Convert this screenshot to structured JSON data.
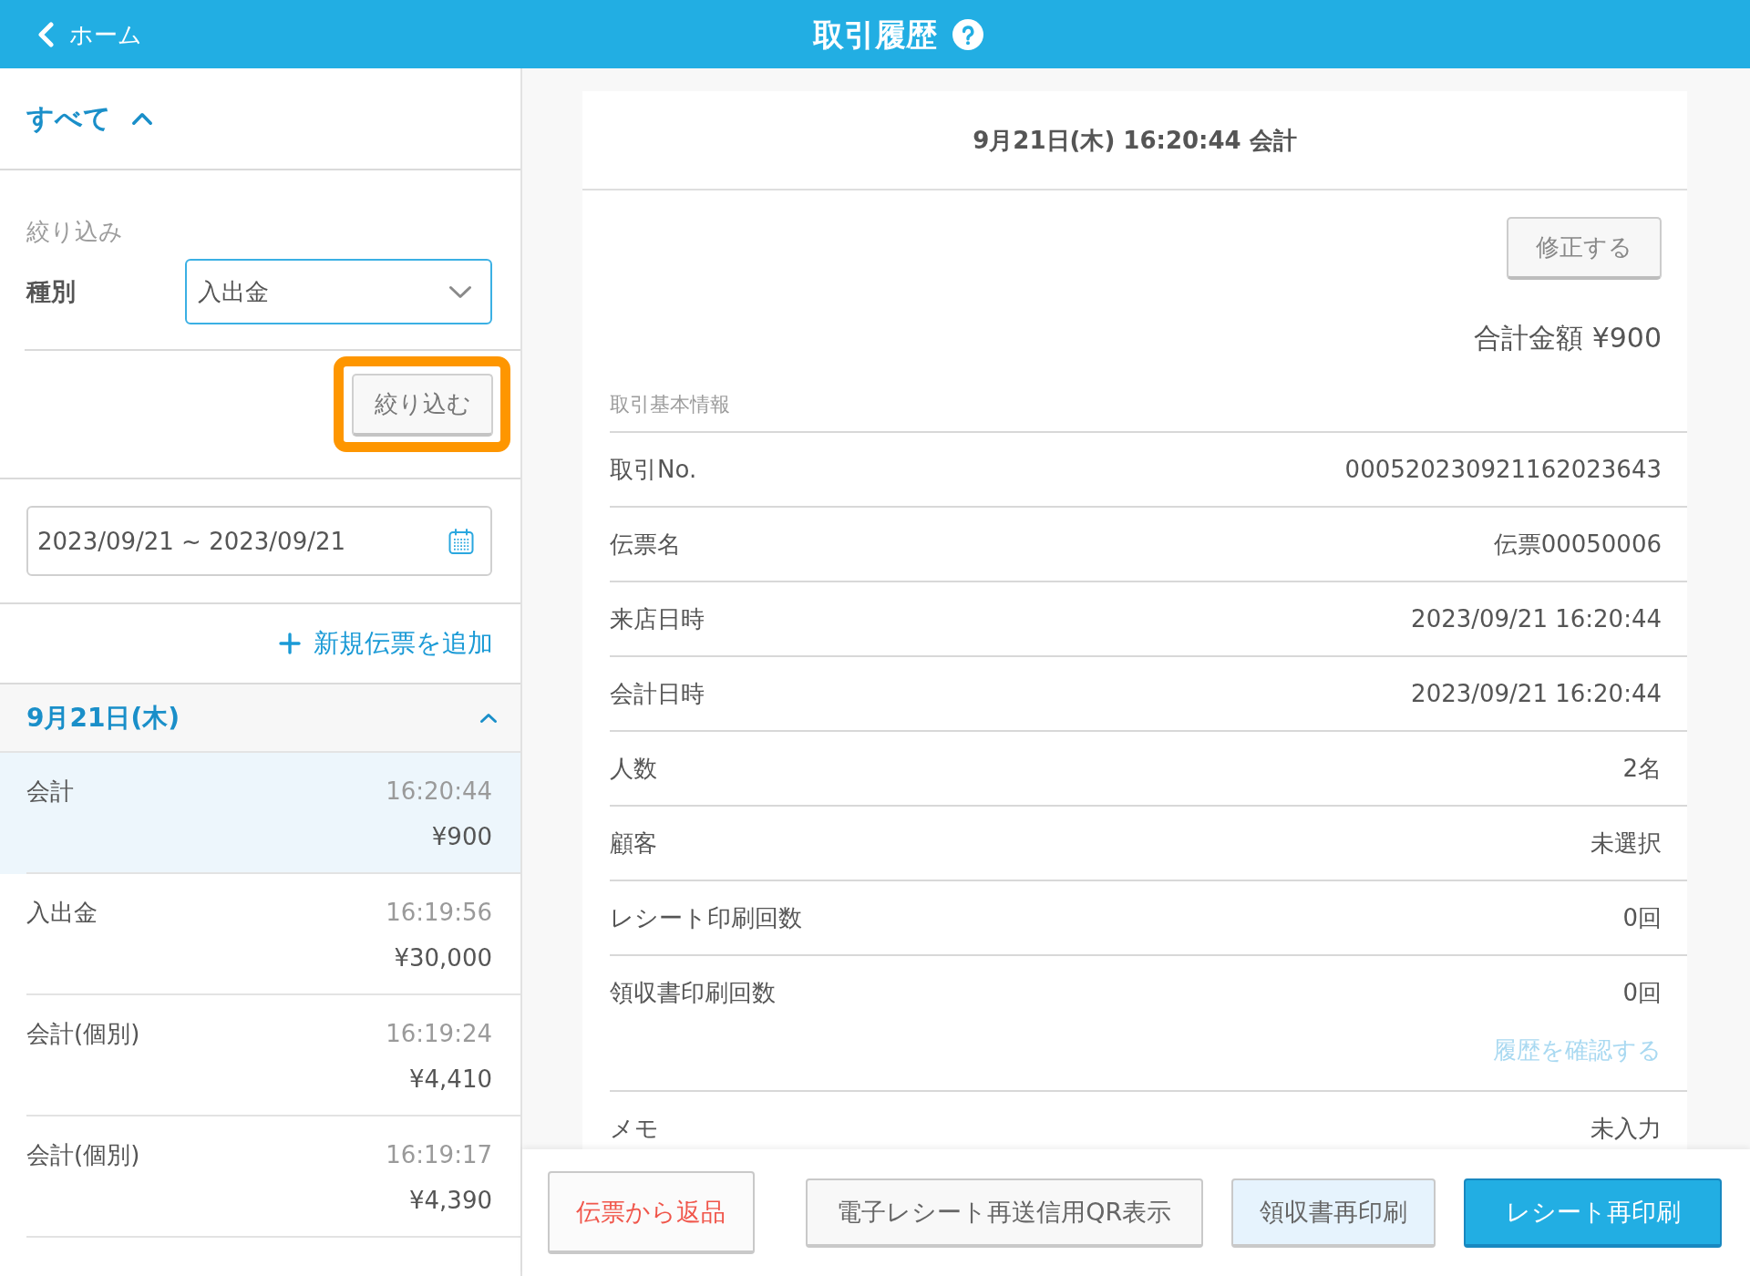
{
  "header": {
    "back_label": "ホーム",
    "title": "取引履歴"
  },
  "sidebar": {
    "scope": {
      "label": "すべて",
      "expanded": true
    },
    "filter": {
      "title": "絞り込み",
      "field_label": "種別",
      "field_value": "入出金",
      "button": {
        "label": "絞り込む",
        "highlighted": true
      }
    },
    "date_range": {
      "value": "2023/09/21 ~ 2023/09/21"
    },
    "add_link": {
      "label": "新規伝票を追加"
    },
    "groups": [
      {
        "date": "9月21日(木)",
        "expanded": true,
        "items": [
          {
            "title": "会計",
            "time": "16:20:44",
            "amount": "¥900",
            "selected": true
          },
          {
            "title": "入出金",
            "time": "16:19:56",
            "amount": "¥30,000",
            "selected": false
          },
          {
            "title": "会計(個別)",
            "time": "16:19:24",
            "amount": "¥4,410",
            "selected": false
          },
          {
            "title": "会計(個別)",
            "time": "16:19:17",
            "amount": "¥4,390",
            "selected": false
          }
        ]
      }
    ]
  },
  "detail": {
    "heading": "9月21日(木) 16:20:44 会計",
    "edit_button": "修正する",
    "total": "合計金額 ¥900",
    "section_title": "取引基本情報",
    "rows": [
      {
        "label": "取引No.",
        "value": "000520230921162023643"
      },
      {
        "label": "伝票名",
        "value": "伝票00050006"
      },
      {
        "label": "来店日時",
        "value": "2023/09/21 16:20:44"
      },
      {
        "label": "会計日時",
        "value": "2023/09/21 16:20:44"
      },
      {
        "label": "人数",
        "value": "2名"
      },
      {
        "label": "顧客",
        "value": "未選択"
      },
      {
        "label": "レシート印刷回数",
        "value": "0回"
      },
      {
        "label": "領収書印刷回数",
        "value": "0回",
        "link": {
          "label": "履歴を確認する",
          "disabled": true
        }
      },
      {
        "label": "メモ",
        "value": "未入力"
      }
    ]
  },
  "actions": [
    {
      "label": "伝票から返品",
      "kind": "danger"
    },
    {
      "label": "電子レシート再送信用QR表示",
      "kind": "default"
    },
    {
      "label": "領収書再印刷",
      "kind": "light"
    },
    {
      "label": "レシート再印刷",
      "kind": "primary"
    }
  ]
}
